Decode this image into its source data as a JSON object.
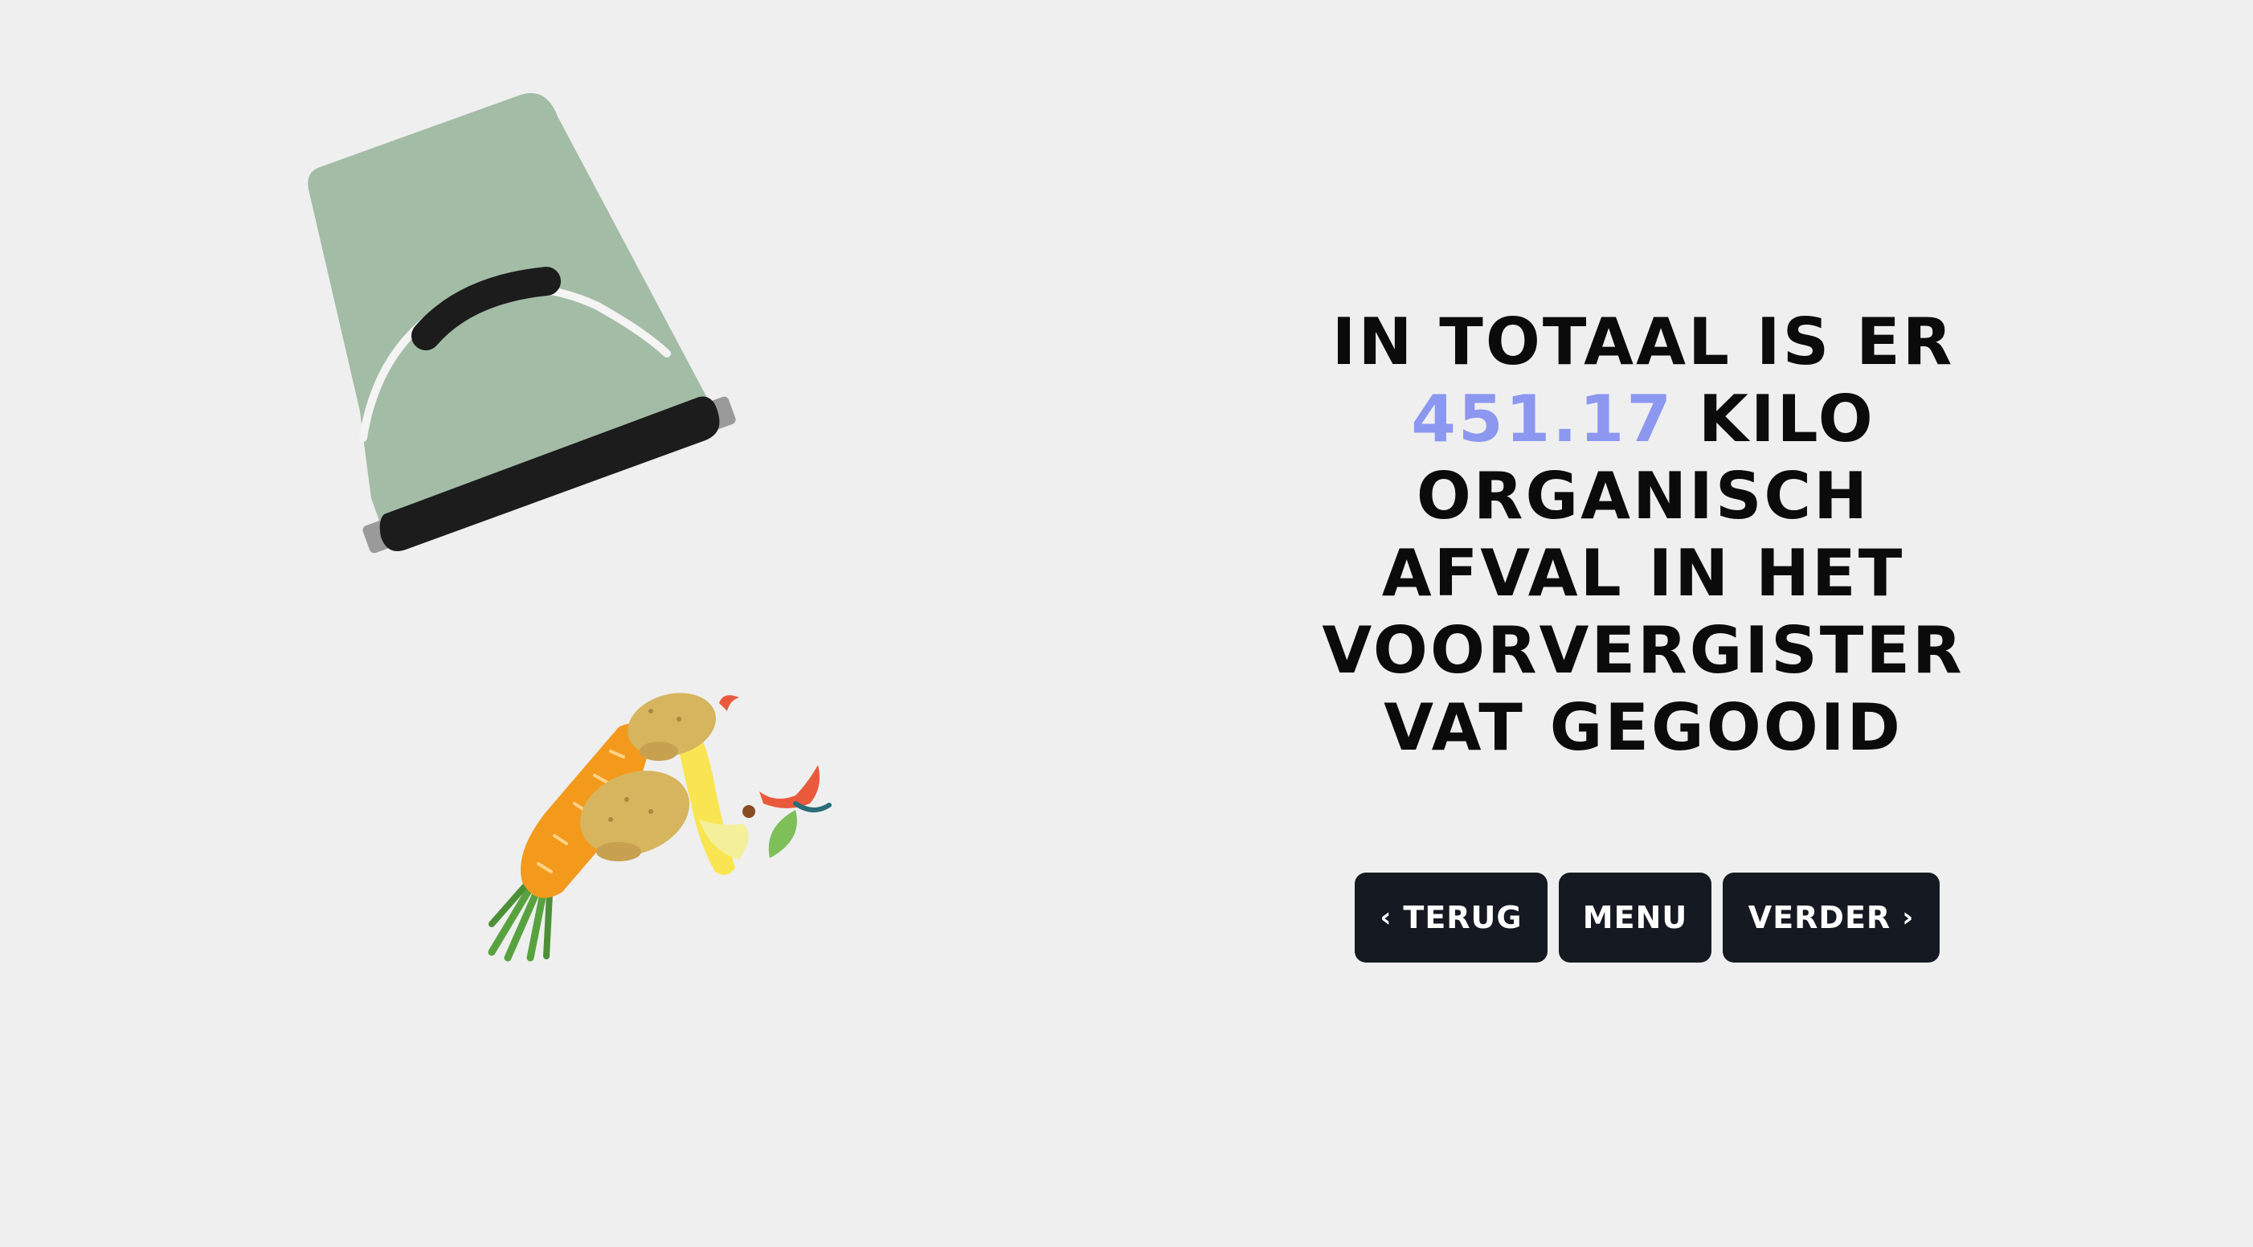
{
  "headline": {
    "before": "In totaal is er",
    "amount": "451.17",
    "after_line1": "kilo",
    "line3": "organisch",
    "line4": "afval in het",
    "line5": "voorvergister",
    "line6": "vat gegooid"
  },
  "nav": {
    "back_icon": "chevron-left-icon",
    "back_label": "TERUG",
    "menu_label": "MENU",
    "next_label": "VERDER",
    "next_icon": "chevron-right-icon"
  },
  "colors": {
    "background": "#efefef",
    "accent": "#8c97f0",
    "bucket": "#a3bca6",
    "button": "#151a22"
  }
}
